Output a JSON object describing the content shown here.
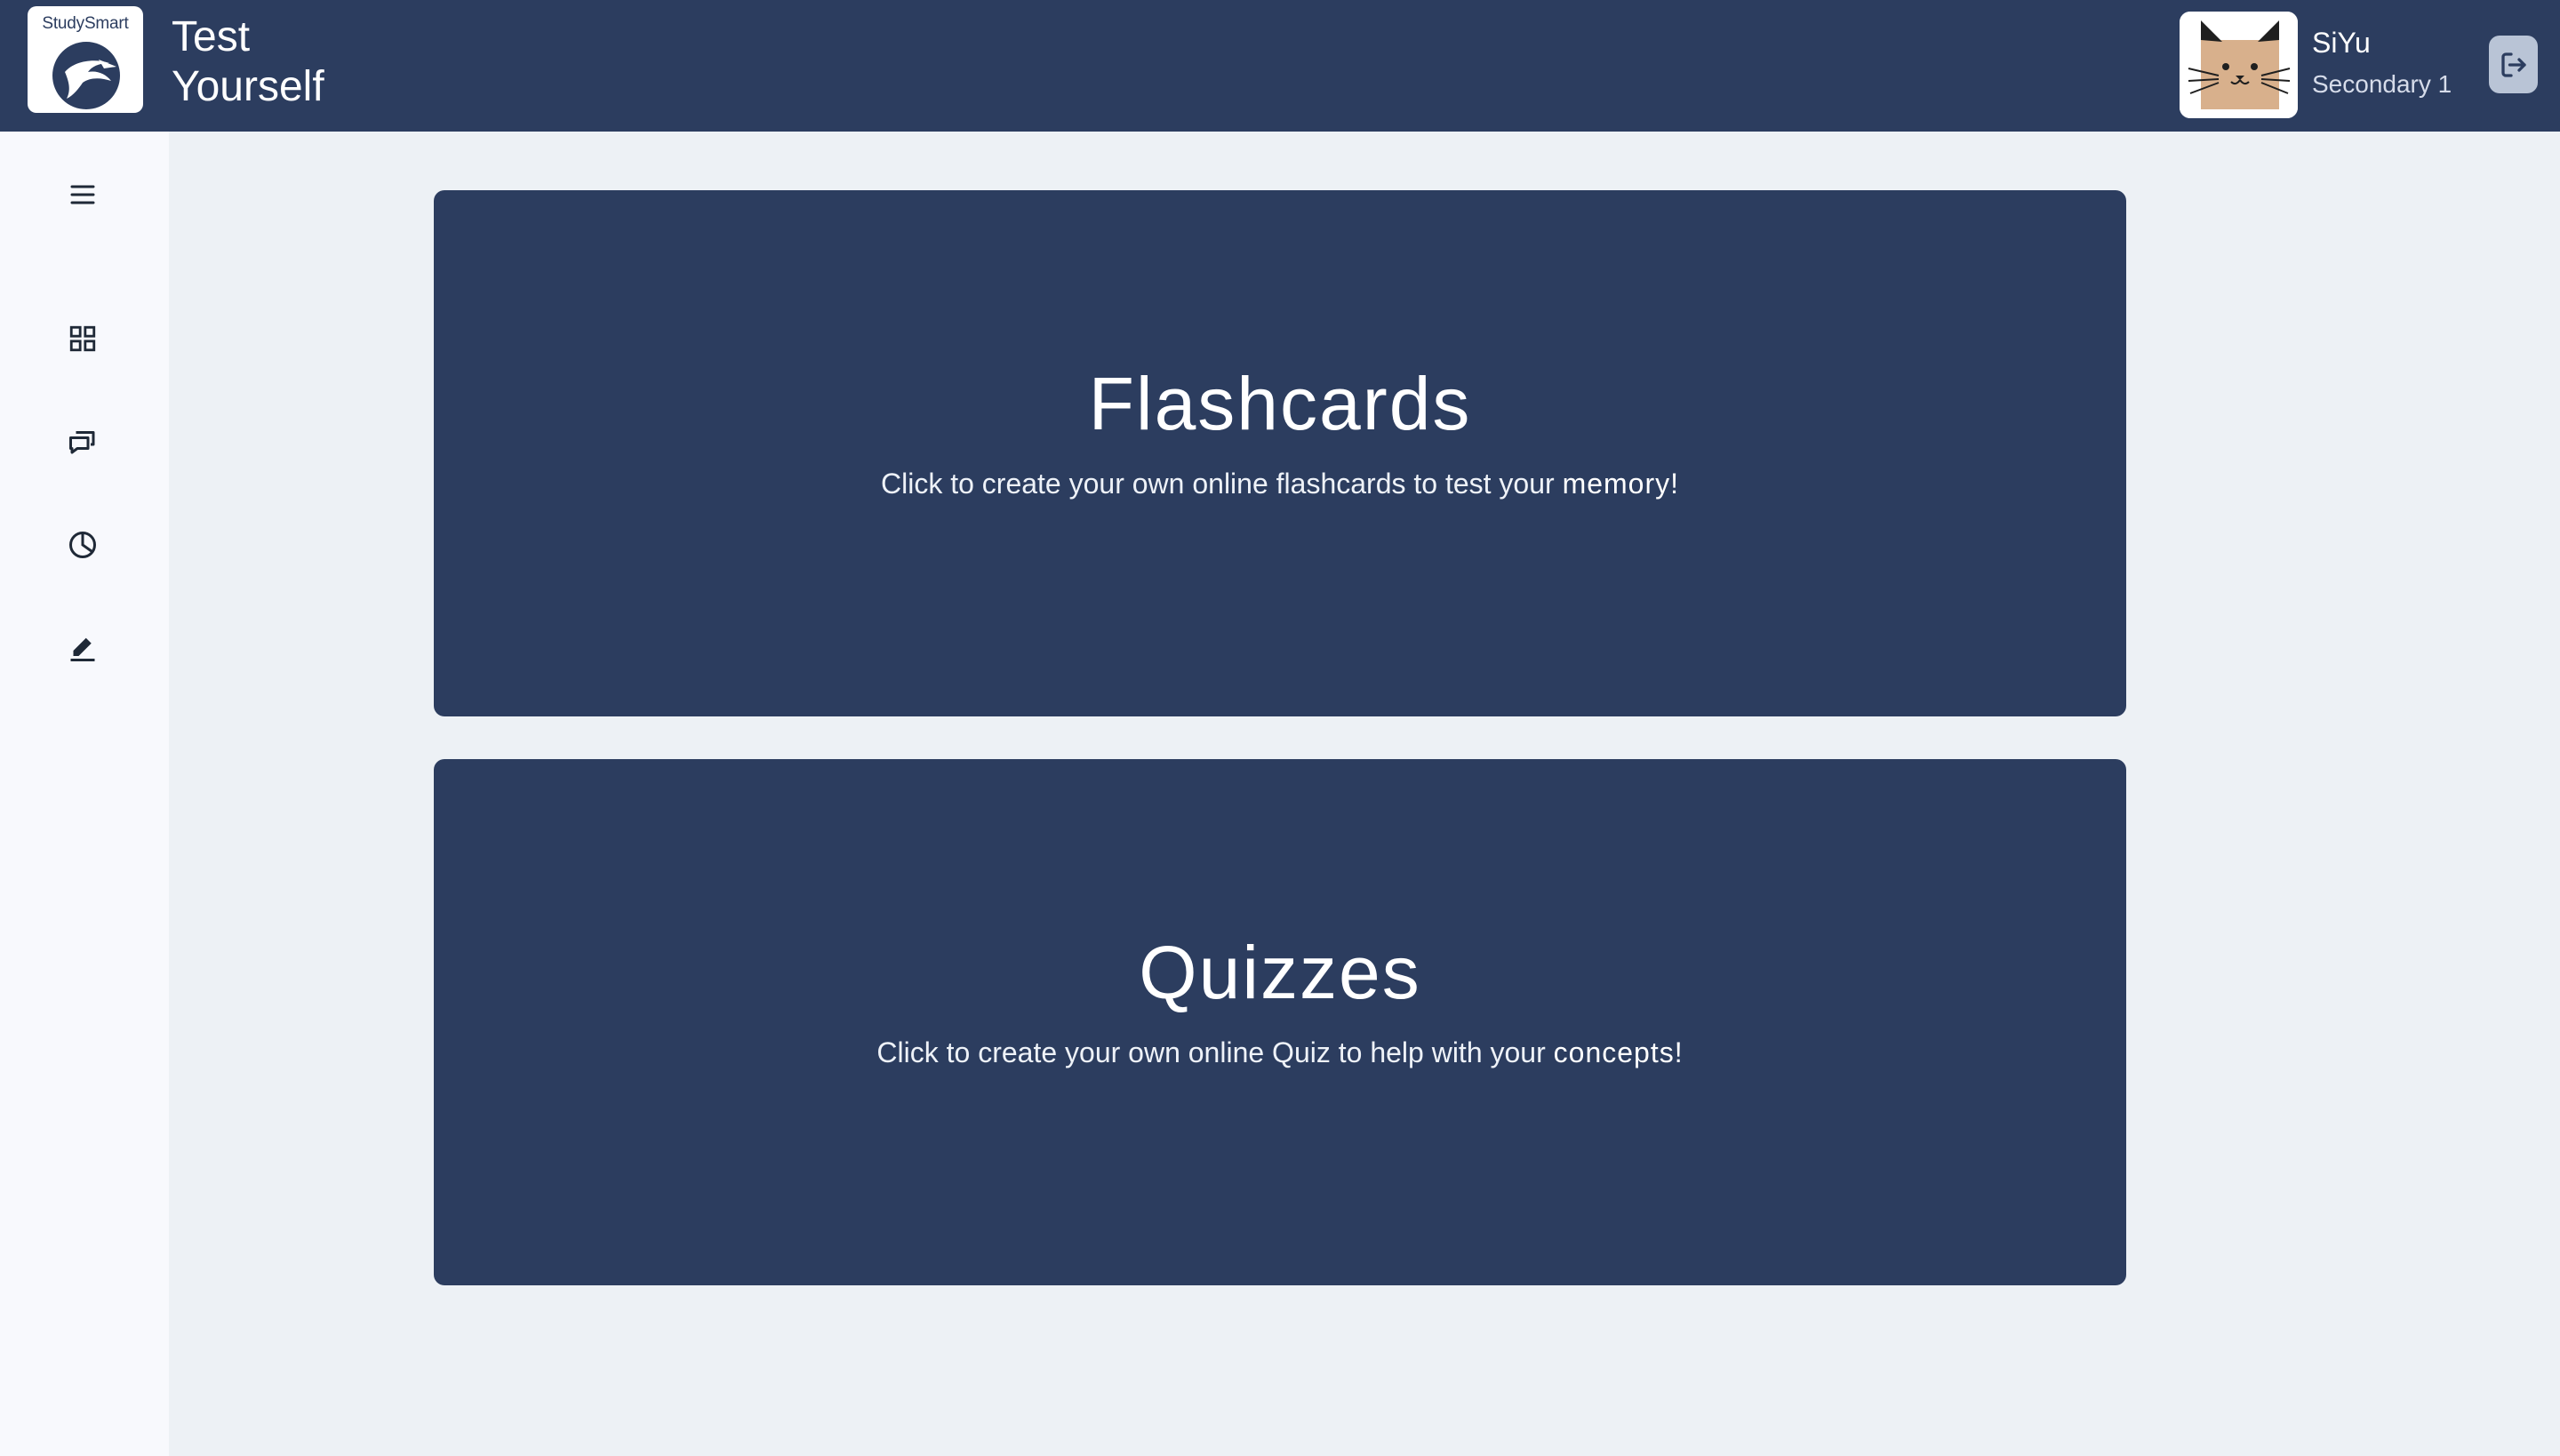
{
  "header": {
    "logo_text": "StudySmart",
    "title_line1": "Test",
    "title_line2": "Yourself",
    "user": {
      "name": "SiYu",
      "level": "Secondary 1"
    }
  },
  "sidebar": {
    "items": [
      {
        "icon": "menu-icon"
      },
      {
        "icon": "dashboard-icon"
      },
      {
        "icon": "chat-icon"
      },
      {
        "icon": "pie-chart-icon"
      },
      {
        "icon": "edit-icon"
      }
    ]
  },
  "cards": [
    {
      "title": "Flashcards",
      "desc_prefix": "Click to create your own online flashcards to test your ",
      "desc_emphasis": "memory!"
    },
    {
      "title": "Quizzes",
      "desc_prefix": "Click to create your own online Quiz to help with your ",
      "desc_emphasis": "concepts!"
    }
  ],
  "colors": {
    "primary": "#2c3d5f",
    "background": "#edf1f5",
    "sidebar": "#f8f9fd",
    "logout_button": "#b9c4d6"
  }
}
